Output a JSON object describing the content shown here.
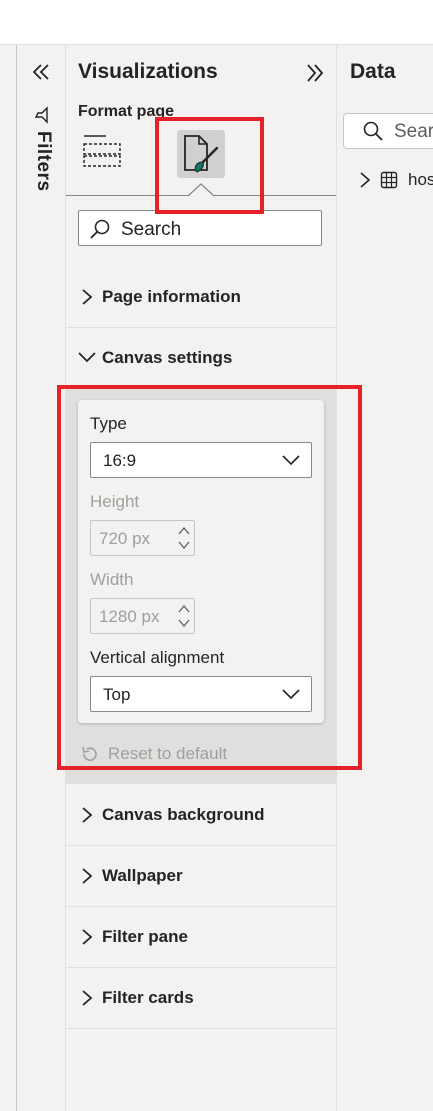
{
  "filters_pane": {
    "label": "Filters",
    "collapse_icon": "double-chevron-left-icon",
    "filter_icon": "funnel-icon"
  },
  "visualizations_pane": {
    "title": "Visualizations",
    "expand_icon": "double-chevron-right-icon",
    "subtitle": "Format page",
    "tabs": [
      {
        "icon": "build-visual-icon",
        "selected": false
      },
      {
        "icon": "format-page-paintbrush-icon",
        "selected": true
      }
    ],
    "search_placeholder": "Search",
    "sections": [
      {
        "title": "Page information",
        "expanded": false
      },
      {
        "title": "Canvas settings",
        "expanded": true
      },
      {
        "title": "Canvas background",
        "expanded": false
      },
      {
        "title": "Wallpaper",
        "expanded": false
      },
      {
        "title": "Filter pane",
        "expanded": false
      },
      {
        "title": "Filter cards",
        "expanded": false
      }
    ],
    "canvas_settings": {
      "type_label": "Type",
      "type_value": "16:9",
      "height_label": "Height",
      "height_value": "720 px",
      "width_label": "Width",
      "width_value": "1280 px",
      "vertical_alignment_label": "Vertical alignment",
      "vertical_alignment_value": "Top",
      "reset_label": "Reset to default"
    }
  },
  "data_pane": {
    "title": "Data",
    "search_placeholder": "Sear",
    "items": [
      {
        "label": "hos"
      }
    ]
  },
  "colors": {
    "highlight": "#e8202a",
    "pane_bg": "#f3f2f1",
    "accent": "#117865"
  }
}
